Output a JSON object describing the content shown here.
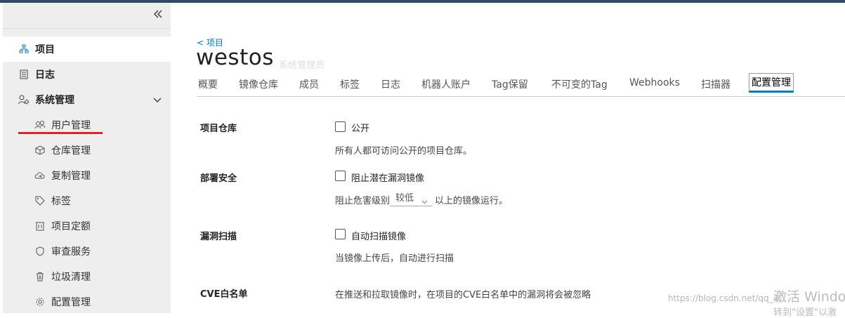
{
  "sidebar": {
    "collapse_label": "«",
    "items": [
      {
        "label": "项目",
        "icon": "project-icon"
      },
      {
        "label": "日志",
        "icon": "log-icon"
      },
      {
        "label": "系统管理",
        "icon": "system-admin-icon"
      }
    ],
    "subitems": [
      {
        "label": "用户管理",
        "icon": "users-icon"
      },
      {
        "label": "仓库管理",
        "icon": "cube-icon"
      },
      {
        "label": "复制管理",
        "icon": "cloud-sync-icon"
      },
      {
        "label": "标签",
        "icon": "tag-icon"
      },
      {
        "label": "项目定额",
        "icon": "quota-icon"
      },
      {
        "label": "审查服务",
        "icon": "shield-icon"
      },
      {
        "label": "垃圾清理",
        "icon": "trash-icon"
      },
      {
        "label": "配置管理",
        "icon": "gear-icon"
      }
    ]
  },
  "header": {
    "back_label": "< 项目",
    "title": "westos",
    "role": "系统管理员"
  },
  "tabs": [
    "概要",
    "镜像仓库",
    "成员",
    "标签",
    "日志",
    "机器人账户",
    "Tag保留",
    "不可变的Tag",
    "Webhooks",
    "扫描器",
    "配置管理"
  ],
  "config": {
    "repo": {
      "label": "项目仓库",
      "checkbox": "公开",
      "help": "所有人都可访问公开的项目仓库。"
    },
    "deploy": {
      "label": "部署安全",
      "checkbox": "阻止潜在漏洞镜像",
      "help_before": "阻止危害级别",
      "select_value": "较低",
      "help_after": "以上的镜像运行。"
    },
    "scan": {
      "label": "漏洞扫描",
      "checkbox": "自动扫描镜像",
      "help": "当镜像上传后，自动进行扫描"
    },
    "cve": {
      "label": "CVE白名单",
      "help": "在推送和拉取镜像时，在项目的CVE白名单中的漏洞将会被忽略"
    }
  },
  "overlay": {
    "watermark": "https://blog.csdn.net/qq_4...",
    "activate_line1": "激活 Windo",
    "activate_line2": "转到\"设置\"以激"
  }
}
